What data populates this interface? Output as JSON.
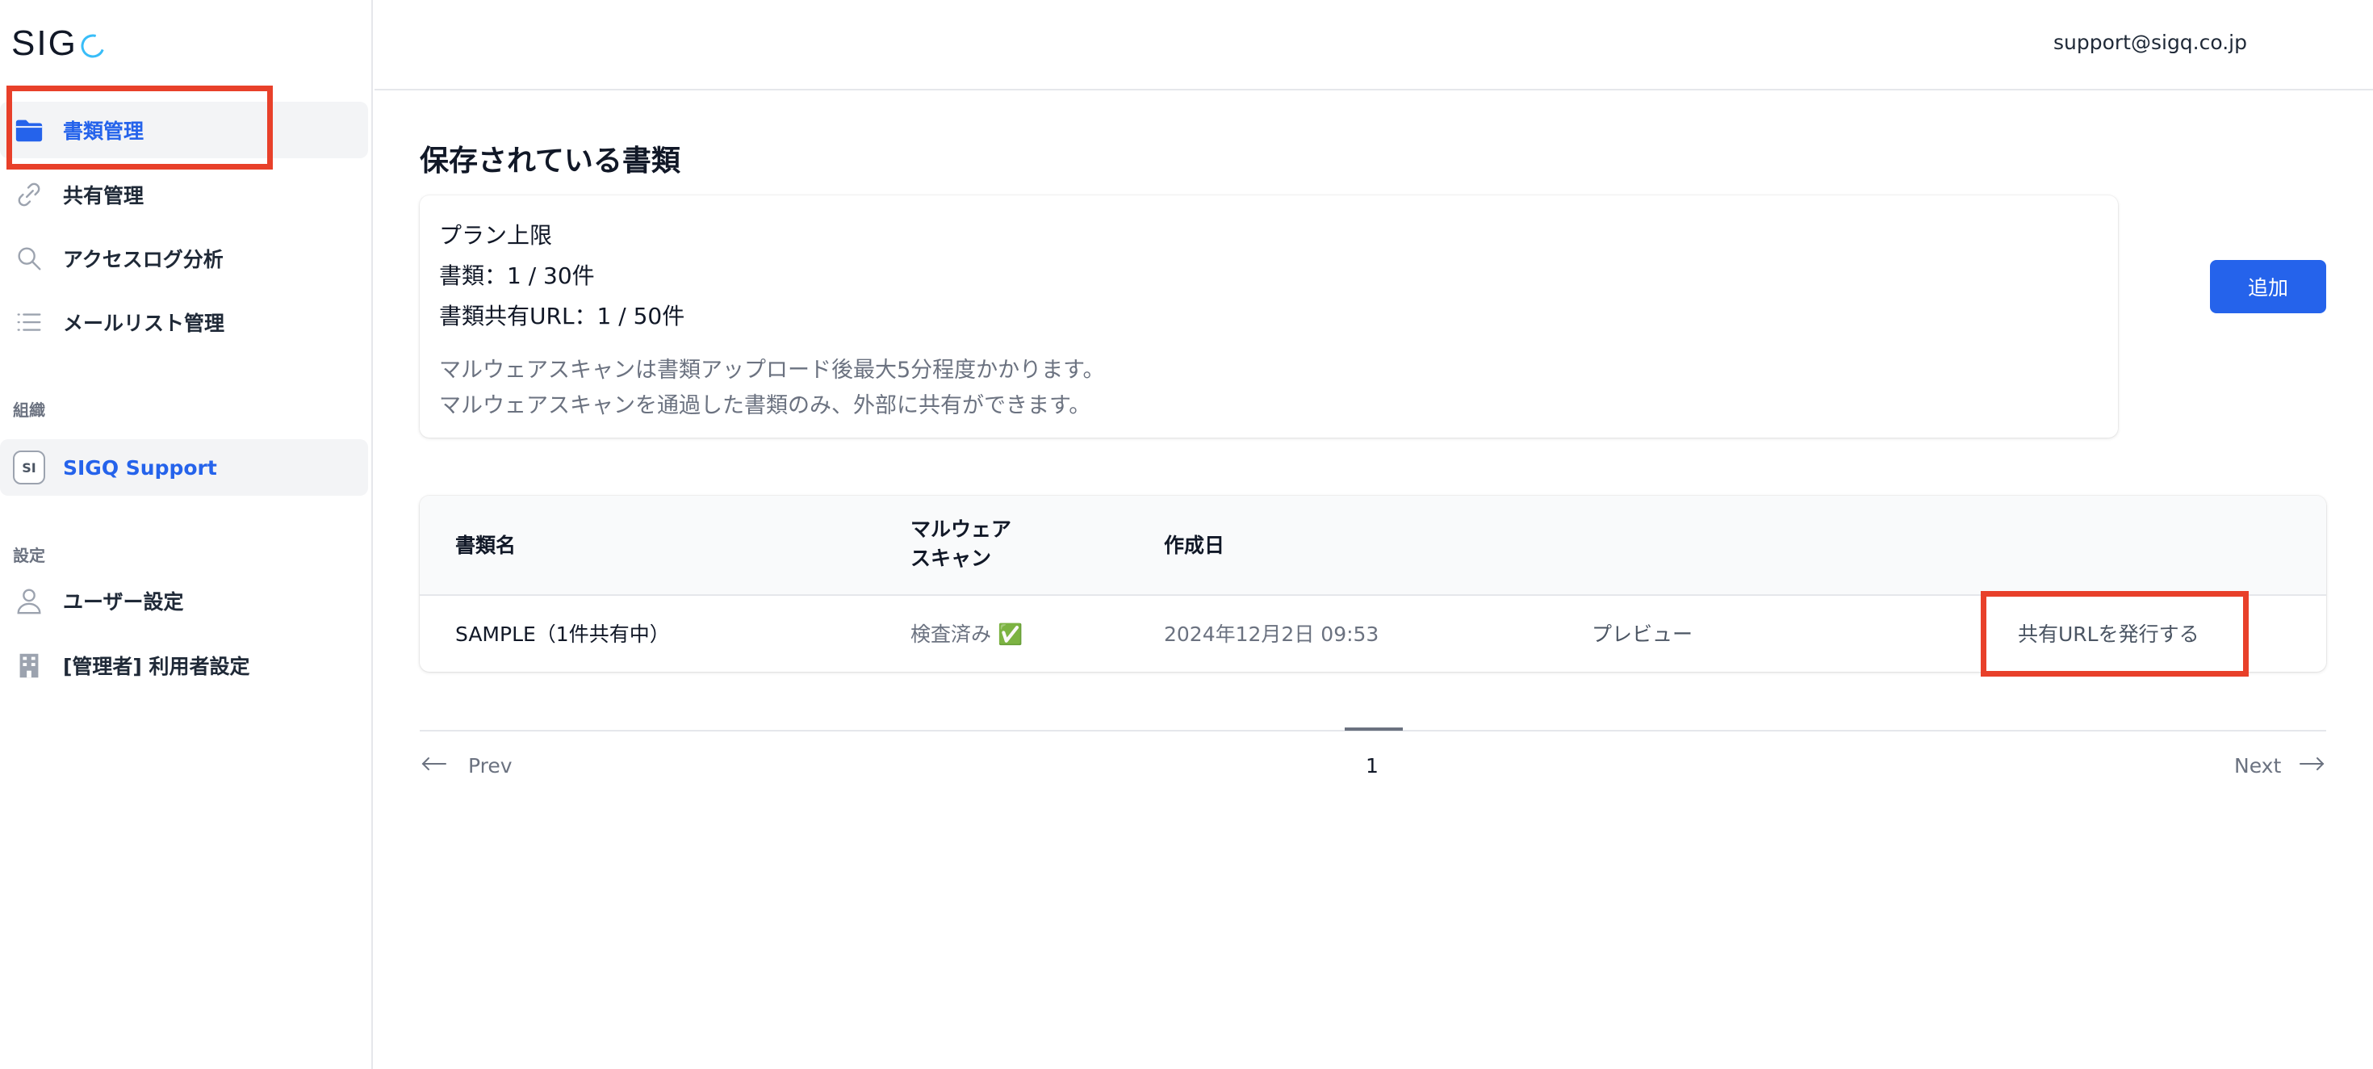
{
  "brand": {
    "logo_text": "SIG"
  },
  "header": {
    "email": "support@sigq.co.jp"
  },
  "sidebar": {
    "items": [
      {
        "label": "書類管理",
        "icon": "folder-icon",
        "active": true
      },
      {
        "label": "共有管理",
        "icon": "link-icon"
      },
      {
        "label": "アクセスログ分析",
        "icon": "search-icon"
      },
      {
        "label": "メールリスト管理",
        "icon": "list-icon"
      }
    ],
    "org_section_title": "組織",
    "org": {
      "avatar_text": "SI",
      "name": "SIGQ Support"
    },
    "settings_section_title": "設定",
    "settings_items": [
      {
        "label": "ユーザー設定",
        "icon": "user-icon"
      },
      {
        "label": "[管理者] 利用者設定",
        "icon": "building-icon"
      }
    ]
  },
  "main": {
    "title": "保存されている書類",
    "plan": {
      "heading": "プラン上限",
      "documents": "書類：1 / 30件",
      "share_urls": "書類共有URL：1 / 50件",
      "note_1": "マルウェアスキャンは書類アップロード後最大5分程度かかります。",
      "note_2": "マルウェアスキャンを通過した書類のみ、外部に共有ができます。"
    },
    "add_button": "追加",
    "table": {
      "columns": {
        "name": "書類名",
        "scan_line1": "マルウェア",
        "scan_line2": "スキャン",
        "created": "作成日"
      },
      "rows": [
        {
          "name": "SAMPLE（1件共有中）",
          "scan_status": "検査済み ✅",
          "created": "2024年12月2日 09:53",
          "preview": "プレビュー",
          "issue_url": "共有URLを発行する"
        }
      ]
    },
    "pagination": {
      "prev": "Prev",
      "next": "Next",
      "current_page": "1"
    }
  },
  "colors": {
    "accent": "#2563eb",
    "highlight": "#e8402a",
    "logo_q": "#38bdf8"
  }
}
